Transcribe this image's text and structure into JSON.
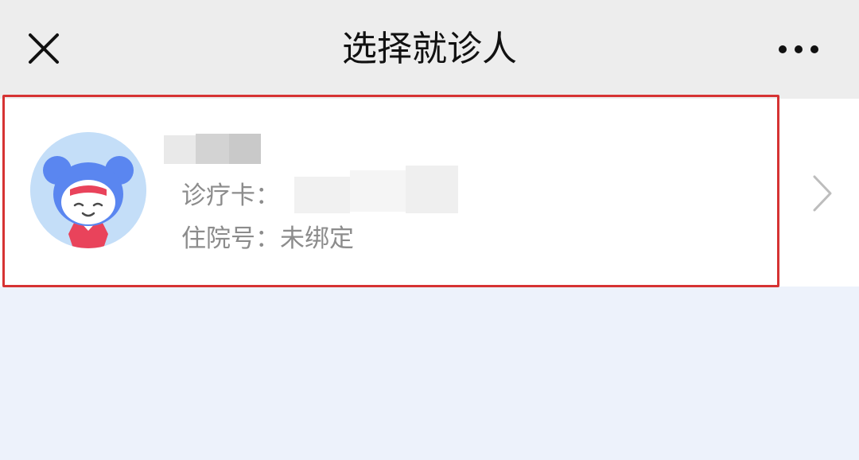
{
  "header": {
    "title": "选择就诊人",
    "close_icon": "close-icon",
    "more_icon": "more-dots-icon"
  },
  "patient": {
    "name": "",
    "card_label": "诊疗卡：",
    "card_value": "",
    "inpatient_label": "住院号：",
    "inpatient_value": "未绑定",
    "avatar_icon": "cartoon-avatar-icon",
    "chevron_icon": "chevron-right-icon"
  },
  "colors": {
    "topbar_bg": "#ededed",
    "page_bg": "#edf2fb",
    "highlight_border": "#d63333",
    "avatar_bg": "#c4def8",
    "label_text": "#8c8c8c"
  }
}
